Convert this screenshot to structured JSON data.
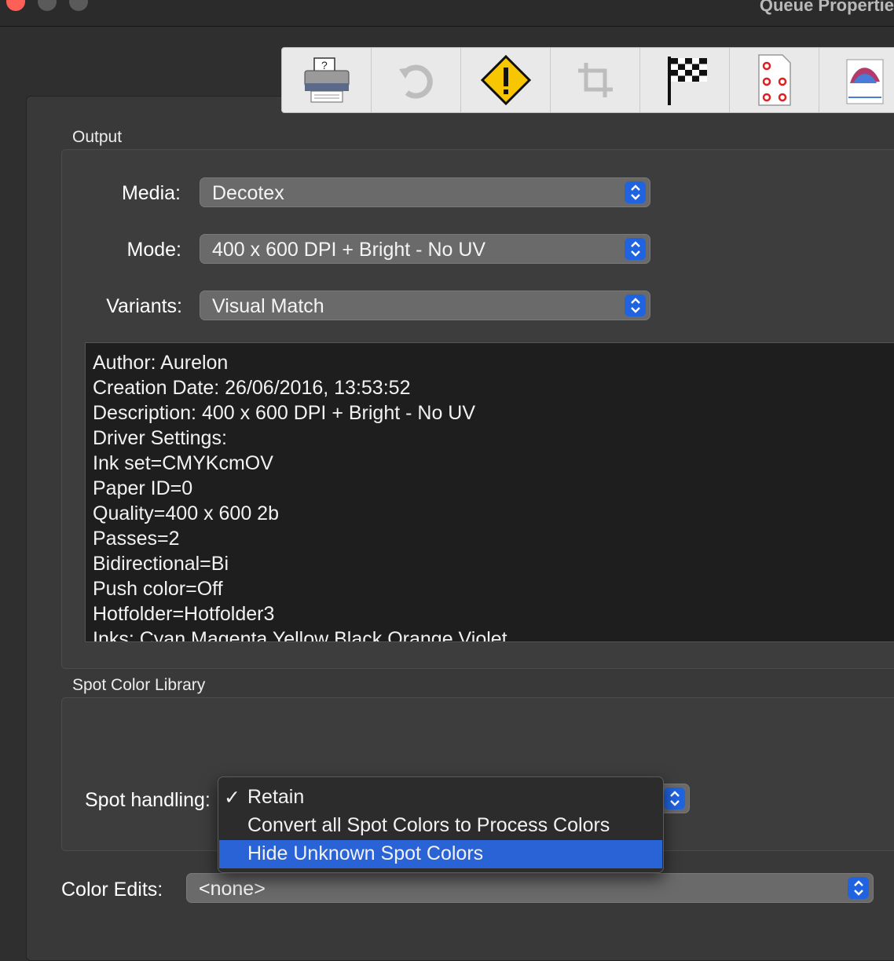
{
  "window": {
    "title": "Queue Propertie"
  },
  "toolbar": {
    "items": [
      {
        "icon": "printer-icon"
      },
      {
        "icon": "refresh-arrow-icon"
      },
      {
        "icon": "warning-icon"
      },
      {
        "icon": "crop-icon"
      },
      {
        "icon": "checkered-flag-icon"
      },
      {
        "icon": "dot-grid-page-icon"
      },
      {
        "icon": "color-profile-icon"
      }
    ]
  },
  "output": {
    "section_label": "Output",
    "media": {
      "label": "Media:",
      "value": "Decotex"
    },
    "mode": {
      "label": "Mode:",
      "value": "400 x 600 DPI + Bright - No UV"
    },
    "variants": {
      "label": "Variants:",
      "value": "Visual Match"
    },
    "details": {
      "lines": [
        "Author: Aurelon",
        "Creation Date: 26/06/2016, 13:53:52",
        "Description: 400 x 600 DPI + Bright - No UV",
        "Driver Settings:",
        "Ink set=CMYKcmOV",
        "Paper ID=0",
        "Quality=400 x 600 2b",
        "Passes=2",
        "Bidirectional=Bi",
        "Push color=Off",
        "Hotfolder=Hotfolder3",
        "Inks: Cyan Magenta Yellow Black Orange Violet"
      ]
    }
  },
  "spot": {
    "section_label": "Spot Color Library",
    "handling_label": "Spot handling:",
    "menu": {
      "check_glyph": "✓",
      "items": [
        {
          "label": "Retain",
          "checked": true,
          "highlighted": false
        },
        {
          "label": "Convert all Spot Colors to Process Colors",
          "checked": false,
          "highlighted": false
        },
        {
          "label": "Hide Unknown Spot Colors",
          "checked": false,
          "highlighted": true
        }
      ]
    }
  },
  "color_edits": {
    "label": "Color Edits:",
    "value": "<none>"
  },
  "colors": {
    "accent": "#2a63d6",
    "stepper": "#1f63e0"
  }
}
